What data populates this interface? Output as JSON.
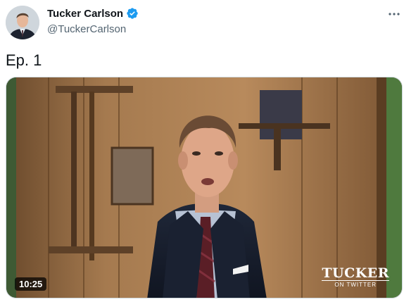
{
  "author": {
    "display_name": "Tucker Carlson",
    "handle": "@TuckerCarlson",
    "verified_icon": "verified-badge-icon",
    "verified_color": "#1d9bf0"
  },
  "more_icon": "more-horizontal-icon",
  "tweet": {
    "text": "Ep. 1"
  },
  "video": {
    "duration": "10:25",
    "logo_main": "TUCKER",
    "logo_sub": "ON TWITTER"
  }
}
